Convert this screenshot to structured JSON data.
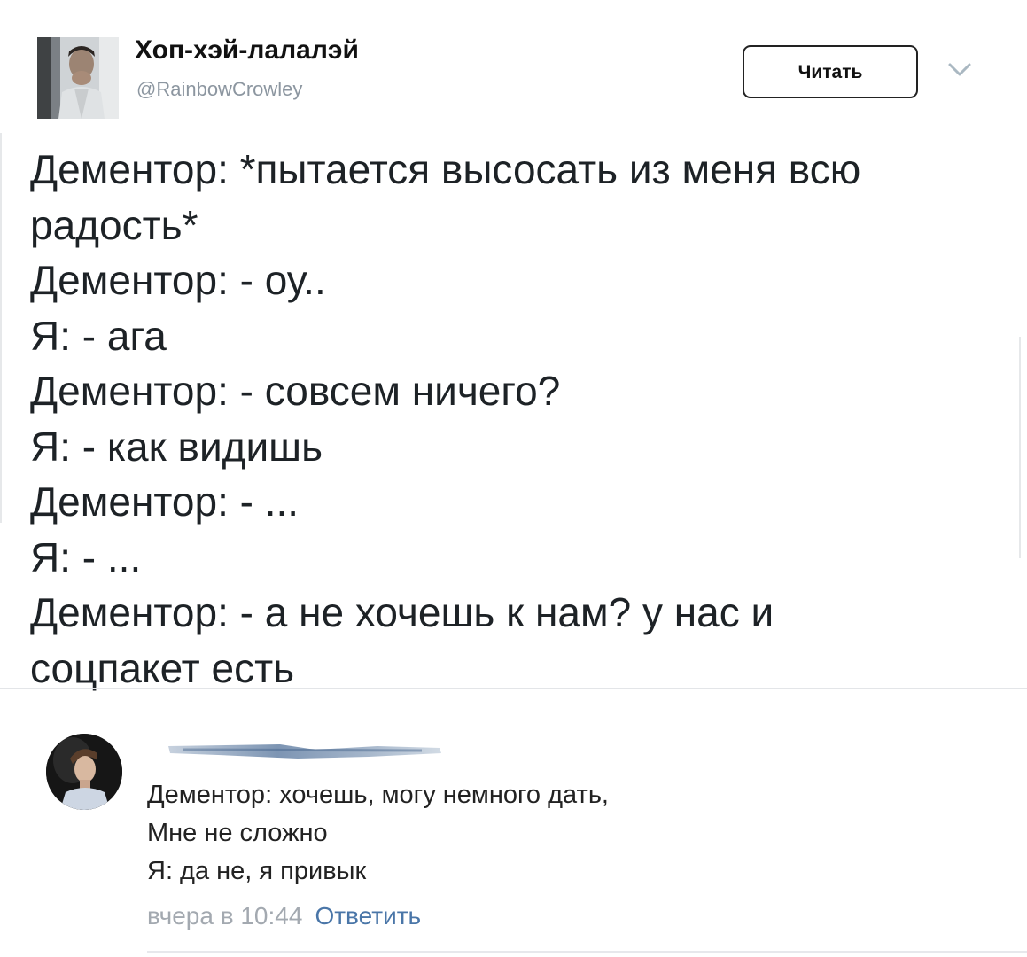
{
  "tweet": {
    "author": {
      "display_name": "Хоп-хэй-лалалэй",
      "username": "@RainbowCrowley"
    },
    "follow_button_label": "Читать",
    "menu_icon": "chevron-down-icon",
    "text": "Дементор: *пытается высосать из меня всю\nрадость*\nДементор: - оу..\nЯ: - ага\nДементор: - совсем ничего?\nЯ: - как видишь\nДементор: - ...\nЯ: - ...\nДементор: - а не хочешь к нам? у нас и\nсоцпакет есть"
  },
  "comment": {
    "author_name_hidden": true,
    "text": "Дементор: хочешь, могу немного дать,\nМне не сложно\nЯ: да не, я привык",
    "date": "вчера в 10:44",
    "reply_label": "Ответить",
    "colors": {
      "link": "#4a76a8",
      "meta": "#a3a9b0"
    }
  }
}
